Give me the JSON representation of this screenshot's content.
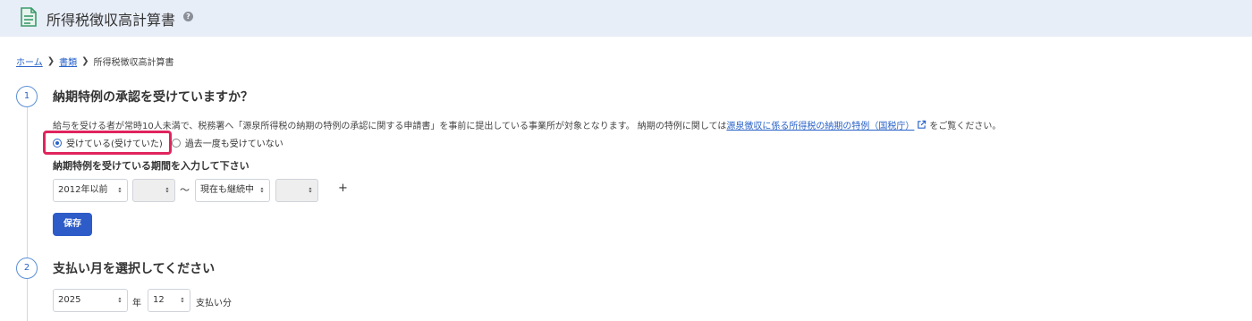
{
  "header": {
    "title": "所得税徴収高計算書",
    "help_icon": "question-circle-icon",
    "help_glyph": "?"
  },
  "breadcrumb": {
    "home": "ホーム",
    "documents": "書類",
    "current": "所得税徴収高計算書"
  },
  "step1": {
    "number": "1",
    "title": "納期特例の承認を受けていますか？",
    "description_before": "給与を受ける者が常時10人未満で、税務署へ「源泉所得税の納期の特例の承認に関する申請書」を事前に提出している事業所が対象となります。 納期の特例に関しては",
    "description_link": "源泉徴収に係る所得税の納期の特例（国税庁）",
    "description_after": "をご覧ください。",
    "radio_options": [
      {
        "label": "受けている(受けていた)",
        "selected": true
      },
      {
        "label": "過去一度も受けていない",
        "selected": false
      }
    ],
    "period_label": "納期特例を受けている期間を入力して下さい",
    "start_year": "2012年以前",
    "start_month": "",
    "tilde": "〜",
    "end_year": "現在も継続中",
    "end_month": "",
    "plus": "+",
    "save_label": "保存"
  },
  "step2": {
    "number": "2",
    "title": "支払い月を選択してください",
    "year": "2025",
    "year_unit": "年",
    "month": "12",
    "month_unit": "支払い分"
  },
  "colors": {
    "header_bg": "#e8eef8",
    "accent": "#2d5cc8",
    "highlight": "#e0245e"
  }
}
